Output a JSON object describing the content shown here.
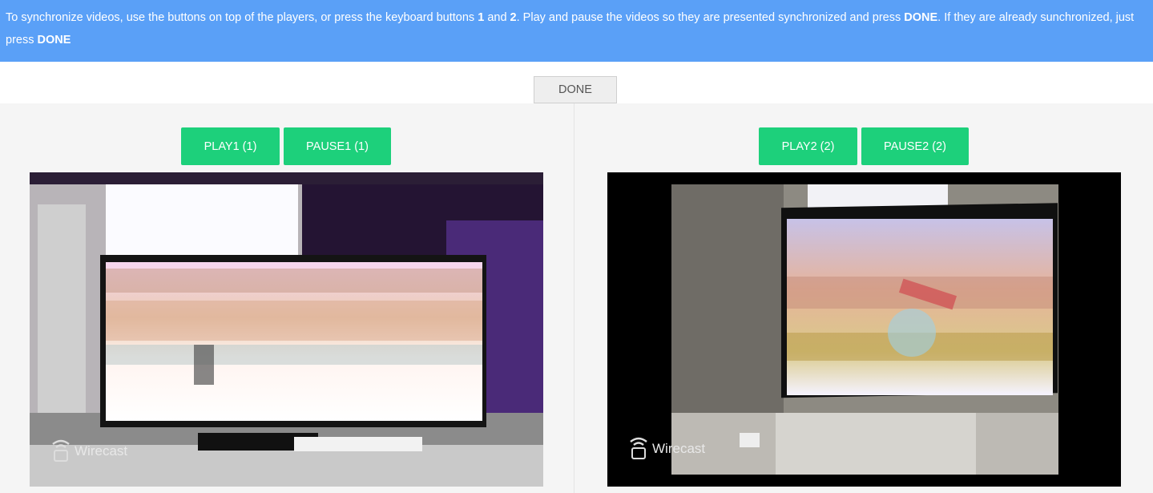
{
  "instructions": {
    "part1": "To synchronize videos, use the buttons on top of the players, or press the keyboard buttons ",
    "key1": "1",
    "part2": " and ",
    "key2": "2",
    "part3": ". Play and pause the videos so they are presented synchronized and press ",
    "done1": "DONE",
    "part4": ". If they are already sunchronized, just press ",
    "done2": "DONE"
  },
  "done_button": "DONE",
  "player1": {
    "play_label": "PLAY1 (1)",
    "pause_label": "PAUSE1 (1)",
    "watermark": "Wirecast"
  },
  "player2": {
    "play_label": "PLAY2 (2)",
    "pause_label": "PAUSE2 (2)",
    "watermark": "Wirecast"
  },
  "colors": {
    "banner": "#5aa0f7",
    "button": "#1dd07b"
  }
}
